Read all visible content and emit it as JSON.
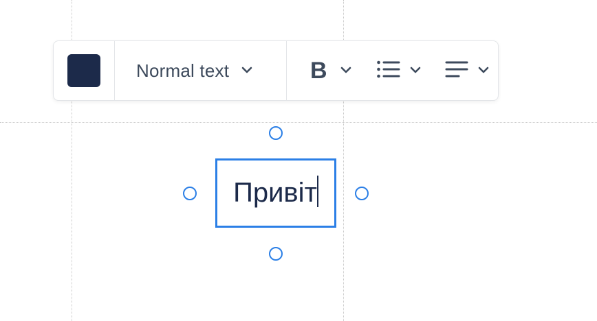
{
  "colors": {
    "accent": "#2b7fe6",
    "swatch": "#1c2a4a",
    "toolbar_text": "#3d4a5c"
  },
  "toolbar": {
    "text_style_label": "Normal text",
    "bold_glyph": "B",
    "icons": {
      "color": "color-swatch",
      "text_style_dropdown": "chevron-down-icon",
      "bold": "bold-icon",
      "list": "bulleted-list-icon",
      "align": "align-left-icon"
    }
  },
  "text_box": {
    "content": "Привіт"
  }
}
